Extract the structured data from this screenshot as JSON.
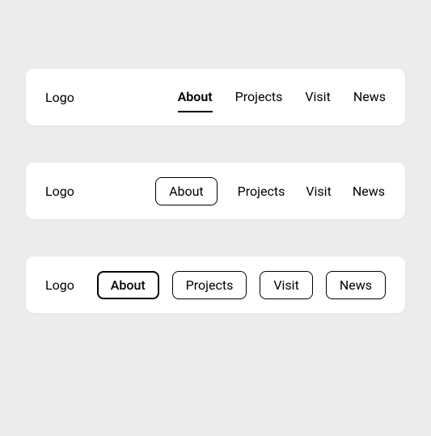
{
  "navbars": [
    {
      "style": "underline",
      "logo": "Logo",
      "items": [
        {
          "label": "About",
          "active": true
        },
        {
          "label": "Projects",
          "active": false
        },
        {
          "label": "Visit",
          "active": false
        },
        {
          "label": "News",
          "active": false
        }
      ]
    },
    {
      "style": "outlined-active",
      "logo": "Logo",
      "items": [
        {
          "label": "About",
          "active": true
        },
        {
          "label": "Projects",
          "active": false
        },
        {
          "label": "Visit",
          "active": false
        },
        {
          "label": "News",
          "active": false
        }
      ]
    },
    {
      "style": "outlined-all",
      "logo": "Logo",
      "items": [
        {
          "label": "About",
          "active": true
        },
        {
          "label": "Projects",
          "active": false
        },
        {
          "label": "Visit",
          "active": false
        },
        {
          "label": "News",
          "active": false
        }
      ]
    }
  ]
}
